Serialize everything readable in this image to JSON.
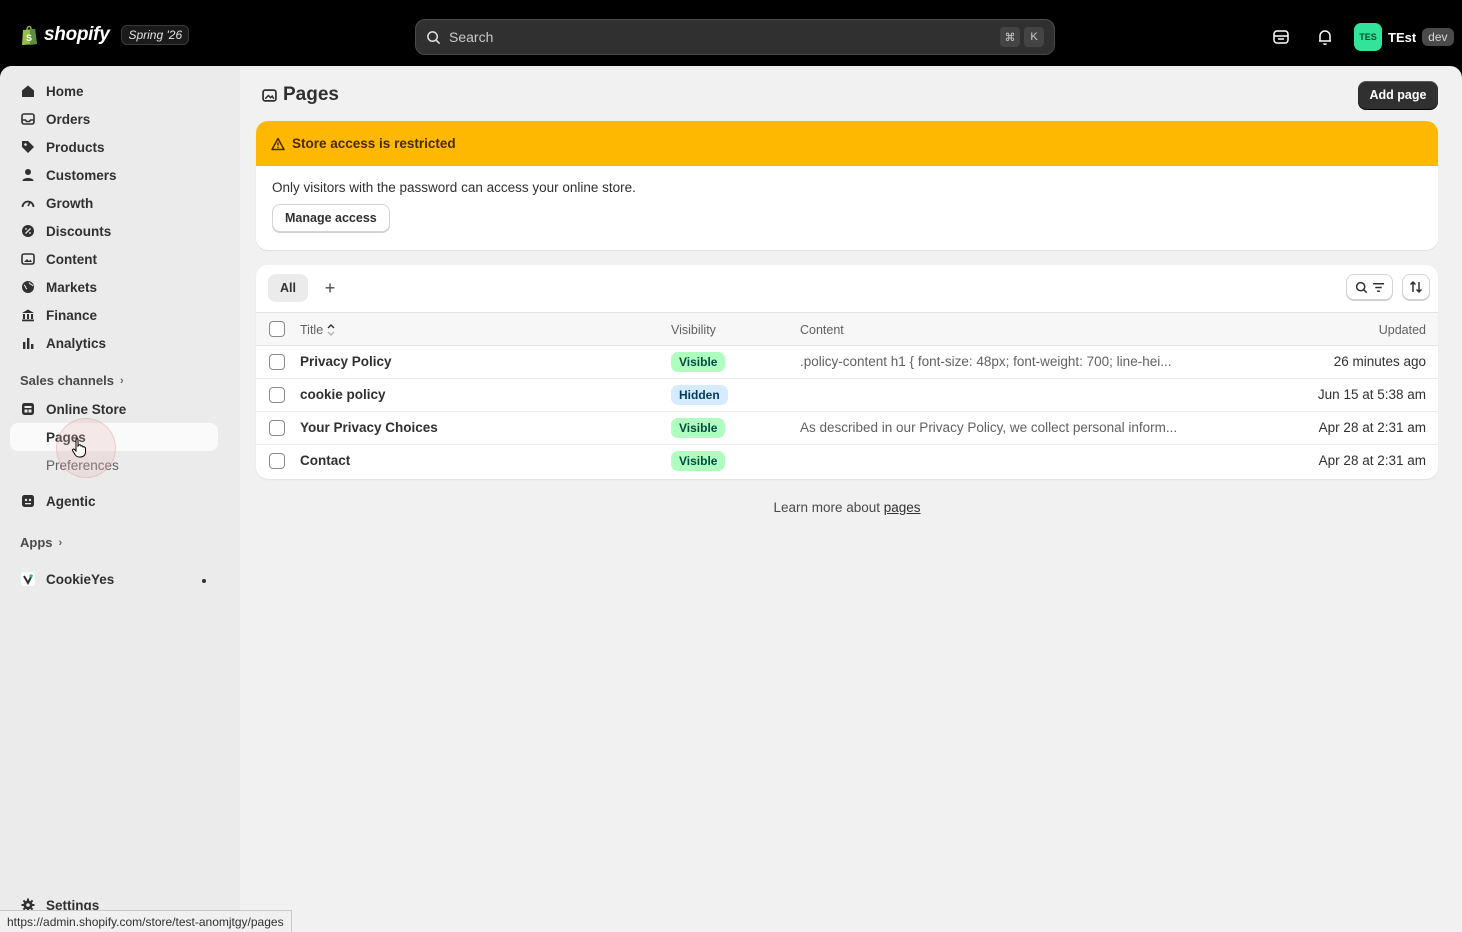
{
  "topbar": {
    "brand": "shopify",
    "version_label": "Spring '26",
    "search_placeholder": "Search",
    "shortcut_keys": [
      "⌘",
      "K"
    ],
    "user_initials": "TES",
    "user_name": "TEst",
    "env_label": "dev",
    "avatar_color": "#32e39a"
  },
  "sidebar": {
    "items": [
      {
        "label": "Home",
        "icon": "home-icon"
      },
      {
        "label": "Orders",
        "icon": "inbox-icon"
      },
      {
        "label": "Products",
        "icon": "tag-icon"
      },
      {
        "label": "Customers",
        "icon": "person-icon"
      },
      {
        "label": "Growth",
        "icon": "gauge-icon"
      },
      {
        "label": "Discounts",
        "icon": "discount-icon"
      },
      {
        "label": "Content",
        "icon": "image-icon"
      },
      {
        "label": "Markets",
        "icon": "globe-icon"
      },
      {
        "label": "Finance",
        "icon": "bank-icon"
      },
      {
        "label": "Analytics",
        "icon": "bar-chart-icon"
      }
    ],
    "sales_channels_label": "Sales channels",
    "online_store_label": "Online Store",
    "sub_items": [
      {
        "label": "Pages",
        "active": true
      },
      {
        "label": "Preferences",
        "active": false
      }
    ],
    "agentic_label": "Agentic",
    "apps_label": "Apps",
    "cookieyes_label": "CookieYes",
    "settings_label": "Settings"
  },
  "page": {
    "title": "Pages",
    "add_button": "Add page"
  },
  "banner": {
    "title": "Store access is restricted",
    "body": "Only visitors with the password can access your online store.",
    "button": "Manage access",
    "color": "#ffb800"
  },
  "table": {
    "tab_all": "All",
    "add_view": "+",
    "columns": {
      "title": "Title",
      "visibility": "Visibility",
      "content": "Content",
      "updated": "Updated"
    },
    "rows": [
      {
        "title": "Privacy Policy",
        "visibility": "Visible",
        "content": ".policy-content h1 { font-size: 48px; font-weight: 700; line-hei...",
        "updated": "26 minutes ago"
      },
      {
        "title": "cookie policy",
        "visibility": "Hidden",
        "content": "",
        "updated": "Jun 15 at 5:38 am"
      },
      {
        "title": "Your Privacy Choices",
        "visibility": "Visible",
        "content": "As described in our Privacy Policy, we collect personal inform...",
        "updated": "Apr 28 at 2:31 am"
      },
      {
        "title": "Contact",
        "visibility": "Visible",
        "content": "",
        "updated": "Apr 28 at 2:31 am"
      }
    ],
    "visible_badge_color": "#affebf",
    "hidden_badge_color": "#d5ebff"
  },
  "footer": {
    "learn_text": "Learn more about ",
    "learn_link": "pages"
  },
  "status_bar": {
    "url": "https://admin.shopify.com/store/test-anomjtgy/pages"
  }
}
